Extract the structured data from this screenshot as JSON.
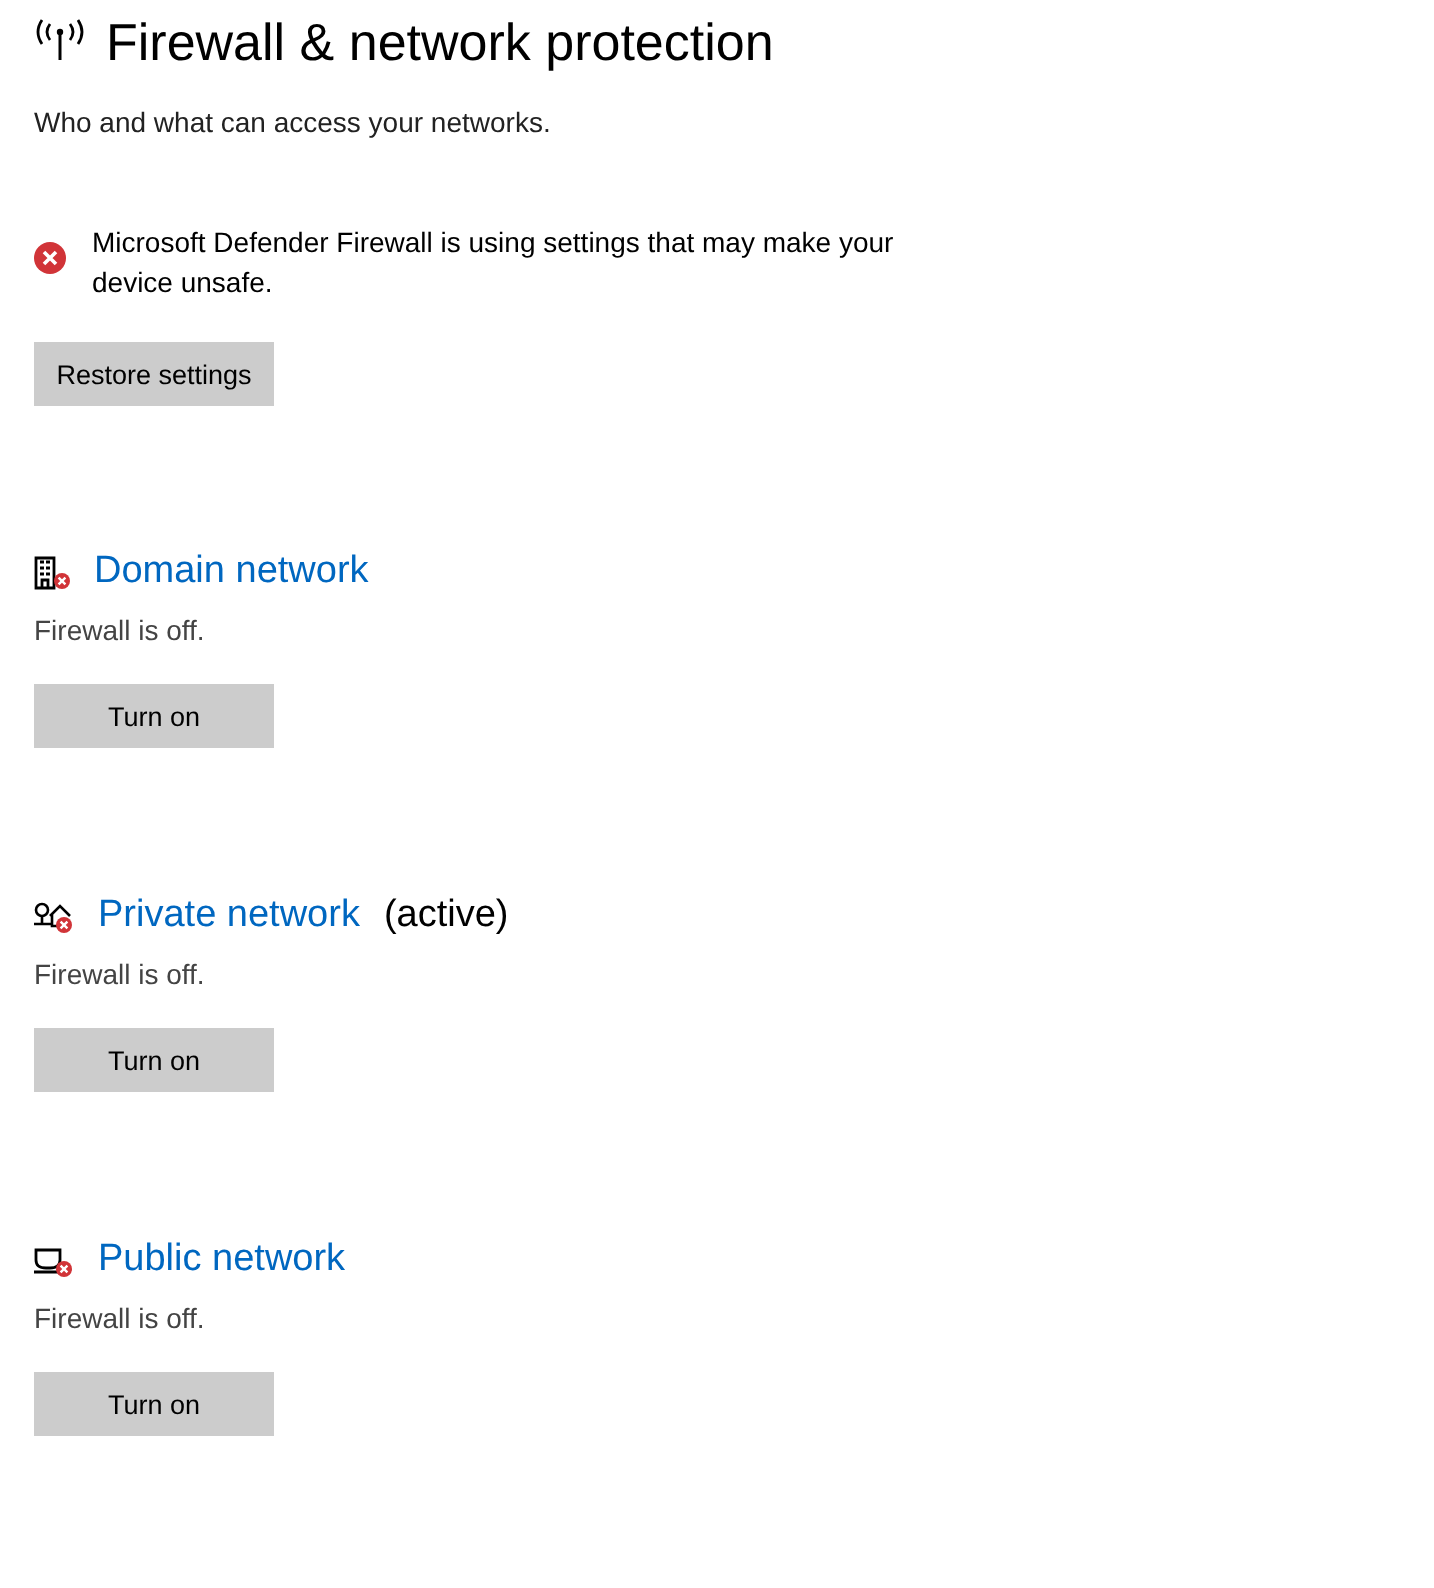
{
  "page": {
    "title": "Firewall & network protection",
    "subtitle": "Who and what can access your networks."
  },
  "alert": {
    "message": "Microsoft Defender Firewall is using settings that may make your device unsafe.",
    "button": "Restore settings"
  },
  "networks": [
    {
      "kind": "domain",
      "name": "Domain network",
      "status": "Firewall is off.",
      "button": "Turn on"
    },
    {
      "kind": "private",
      "name": "Private network",
      "active_label": "(active)",
      "status": "Firewall is off.",
      "button": "Turn on"
    },
    {
      "kind": "public",
      "name": "Public network",
      "status": "Firewall is off.",
      "button": "Turn on"
    }
  ]
}
